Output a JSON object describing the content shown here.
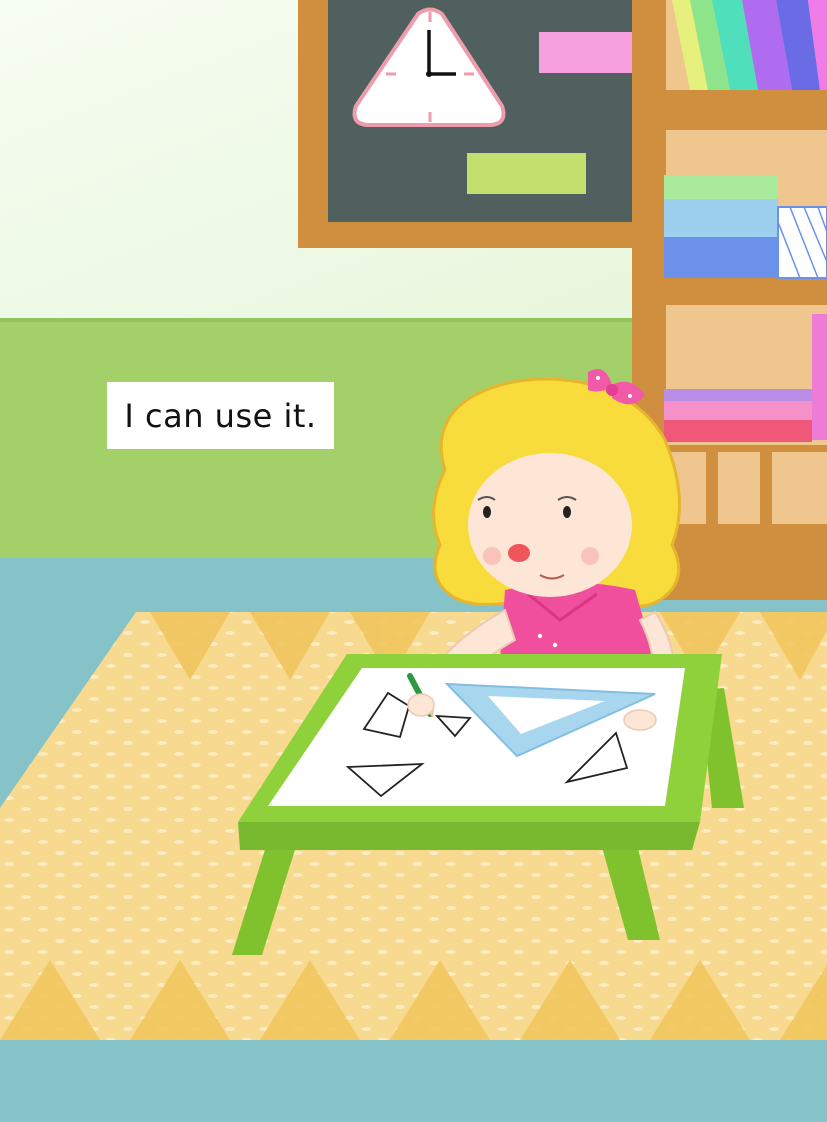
{
  "caption": {
    "text": "I can use it."
  },
  "icons": [
    "clock-icon",
    "set-square-icon",
    "pencil-icon",
    "bow-icon"
  ],
  "colors": {
    "wall_upper": "#eef9e6",
    "wall_lower": "#a4d06a",
    "floor": "#86c3c9",
    "rug": "#f7d98f",
    "chalkboard": "#4f605e",
    "wood_frame": "#cf8f3f",
    "table_green": "#8fd13b",
    "shirt_pink": "#ef4f9d",
    "hair_yellow": "#f7dc3c",
    "set_square_blue": "#a9d6ef"
  }
}
